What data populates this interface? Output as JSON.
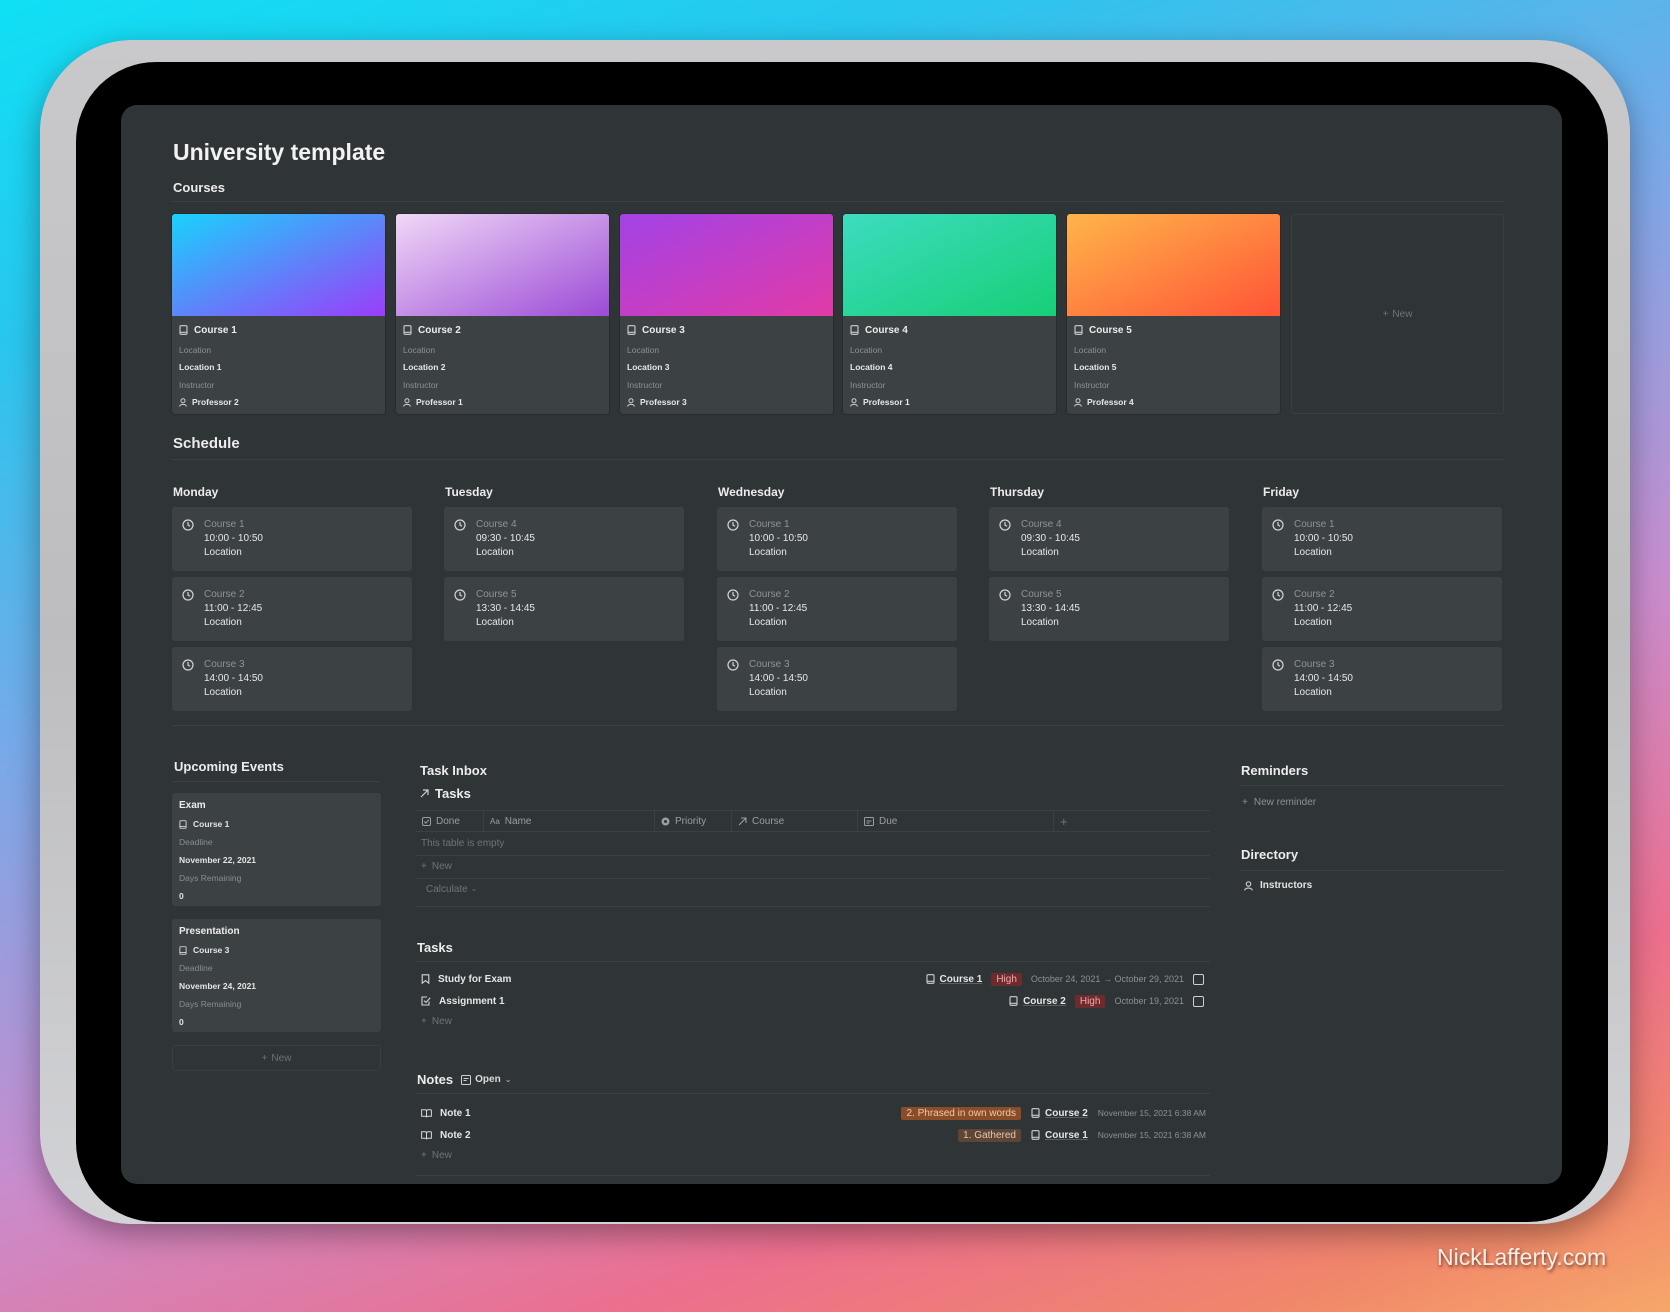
{
  "page_title": "University template",
  "courses": {
    "header": "Courses",
    "location_label": "Location",
    "instructor_label": "Instructor",
    "new_label": "New",
    "items": [
      {
        "name": "Course 1",
        "location": "Location 1",
        "instructor": "Professor 2",
        "gradient": [
          "#19d2fb",
          "#9b3dfa"
        ]
      },
      {
        "name": "Course 2",
        "location": "Location 2",
        "instructor": "Professor 1",
        "gradient": [
          "#f0d8f7",
          "#9c4bd6"
        ]
      },
      {
        "name": "Course 3",
        "location": "Location 3",
        "instructor": "Professor 3",
        "gradient": [
          "#a242e6",
          "#e23aa7"
        ]
      },
      {
        "name": "Course 4",
        "location": "Location 4",
        "instructor": "Professor 1",
        "gradient": [
          "#3ddcc0",
          "#17cf77"
        ]
      },
      {
        "name": "Course 5",
        "location": "Location 5",
        "instructor": "Professor 4",
        "gradient": [
          "#ffb54a",
          "#ff5436"
        ]
      }
    ]
  },
  "schedule": {
    "header": "Schedule",
    "days": [
      {
        "name": "Monday",
        "slots": [
          {
            "course": "Course 1",
            "time": "10:00 - 10:50",
            "location": "Location"
          },
          {
            "course": "Course 2",
            "time": "11:00 - 12:45",
            "location": "Location"
          },
          {
            "course": "Course 3",
            "time": "14:00 - 14:50",
            "location": "Location"
          }
        ]
      },
      {
        "name": "Tuesday",
        "slots": [
          {
            "course": "Course 4",
            "time": "09:30 - 10:45",
            "location": "Location"
          },
          {
            "course": "Course 5",
            "time": "13:30 - 14:45",
            "location": "Location"
          }
        ]
      },
      {
        "name": "Wednesday",
        "slots": [
          {
            "course": "Course 1",
            "time": "10:00 - 10:50",
            "location": "Location"
          },
          {
            "course": "Course 2",
            "time": "11:00 - 12:45",
            "location": "Location"
          },
          {
            "course": "Course 3",
            "time": "14:00 - 14:50",
            "location": "Location"
          }
        ]
      },
      {
        "name": "Thursday",
        "slots": [
          {
            "course": "Course 4",
            "time": "09:30 - 10:45",
            "location": "Location"
          },
          {
            "course": "Course 5",
            "time": "13:30 - 14:45",
            "location": "Location"
          }
        ]
      },
      {
        "name": "Friday",
        "slots": [
          {
            "course": "Course 1",
            "time": "10:00 - 10:50",
            "location": "Location"
          },
          {
            "course": "Course 2",
            "time": "11:00 - 12:45",
            "location": "Location"
          },
          {
            "course": "Course 3",
            "time": "14:00 - 14:50",
            "location": "Location"
          }
        ]
      }
    ]
  },
  "upcoming_events": {
    "header": "Upcoming Events",
    "deadline_label": "Deadline",
    "days_remaining_label": "Days Remaining",
    "new_label": "New",
    "items": [
      {
        "title": "Exam",
        "course": "Course 1",
        "deadline": "November 22, 2021",
        "days_remaining": "0"
      },
      {
        "title": "Presentation",
        "course": "Course 3",
        "deadline": "November 24, 2021",
        "days_remaining": "0"
      }
    ]
  },
  "task_inbox": {
    "header": "Task Inbox",
    "link_title": "Tasks",
    "columns": [
      "Done",
      "Name",
      "Priority",
      "Course",
      "Due"
    ],
    "empty_text": "This table is empty",
    "new_label": "New",
    "calculate_label": "Calculate"
  },
  "tasks": {
    "header": "Tasks",
    "new_label": "New",
    "items": [
      {
        "name": "Study for Exam",
        "course": "Course 1",
        "priority": "High",
        "due": "October 24, 2021 → October 29, 2021",
        "done": false
      },
      {
        "name": "Assignment 1",
        "course": "Course 2",
        "priority": "High",
        "due": "October 19, 2021",
        "done": false
      }
    ]
  },
  "notes": {
    "header": "Notes",
    "view_label": "Open",
    "new_label": "New",
    "items": [
      {
        "name": "Note 1",
        "status": "2. Phrased in own words",
        "course": "Course 2",
        "created": "November 15, 2021 6:38 AM"
      },
      {
        "name": "Note 2",
        "status": "1. Gathered",
        "course": "Course 1",
        "created": "November 15, 2021 6:38 AM"
      }
    ]
  },
  "reminders": {
    "header": "Reminders",
    "new_label": "New reminder"
  },
  "directory": {
    "header": "Directory",
    "items": [
      "Instructors"
    ]
  },
  "watermark": "NickLafferty.com"
}
